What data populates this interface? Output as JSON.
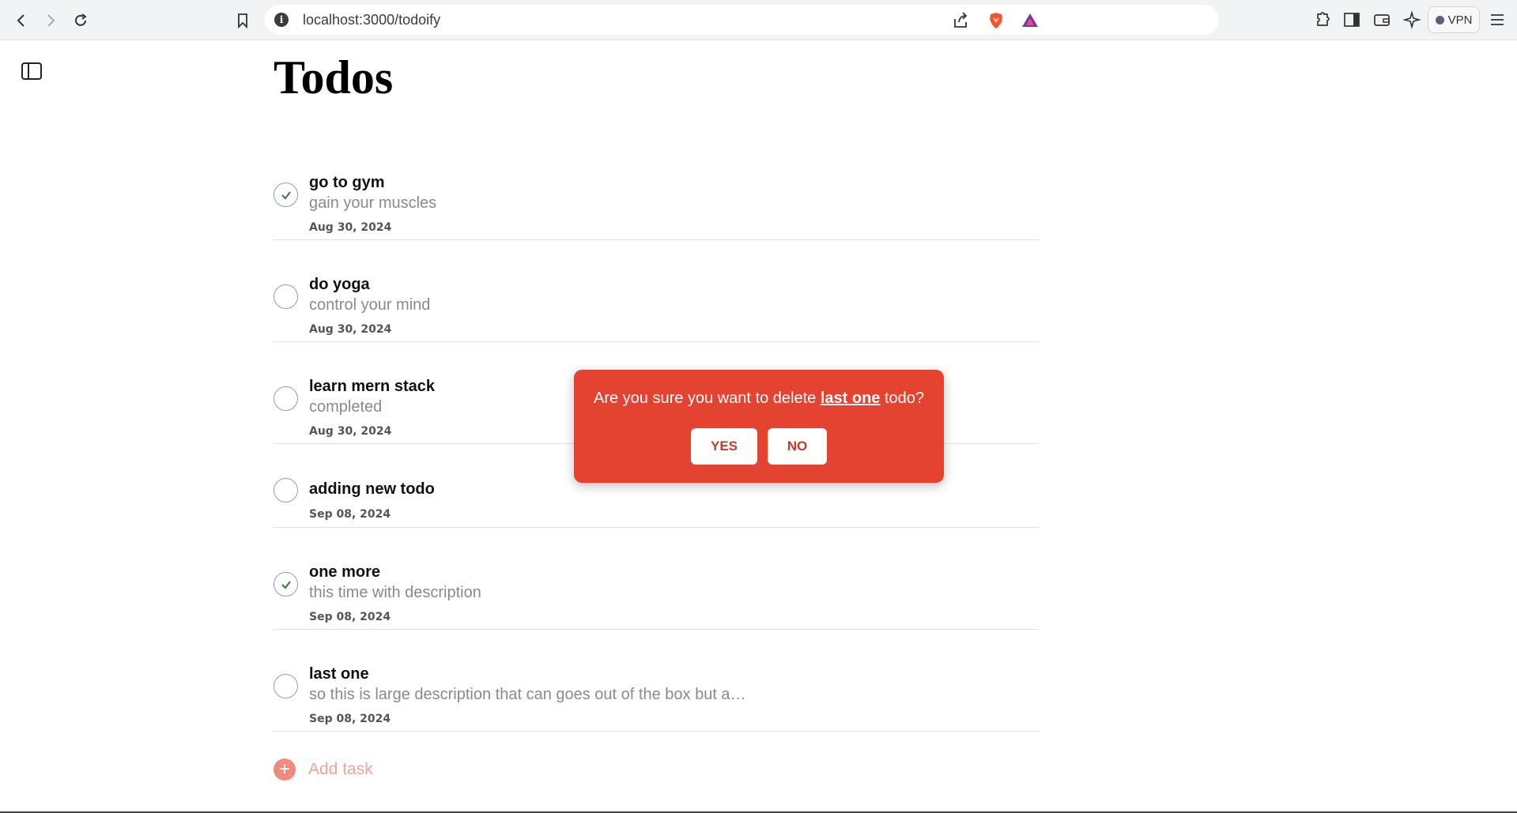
{
  "browser": {
    "url": "localhost:3000/todoify",
    "vpn_label": "VPN"
  },
  "page": {
    "title": "Todos"
  },
  "todos": [
    {
      "title": "go to gym",
      "description": "gain your muscles",
      "date": "Aug 30, 2024",
      "completed": true
    },
    {
      "title": "do yoga",
      "description": "control your mind",
      "date": "Aug 30, 2024",
      "completed": false
    },
    {
      "title": "learn mern stack",
      "description": "completed",
      "date": "Aug 30, 2024",
      "completed": false
    },
    {
      "title": "adding new todo",
      "description": "",
      "date": "Sep 08, 2024",
      "completed": false
    },
    {
      "title": "one more",
      "description": "this time with description",
      "date": "Sep 08, 2024",
      "completed": true
    },
    {
      "title": "last one",
      "description": "so this is large description that can goes out of the box but a…",
      "date": "Sep 08, 2024",
      "completed": false
    }
  ],
  "add_task": {
    "label": "Add task"
  },
  "dialog": {
    "message_prefix": "Are you sure you want to delete ",
    "todo_name": "last one",
    "message_suffix": " todo?",
    "yes_label": "YES",
    "no_label": "NO"
  },
  "colors": {
    "accent": "#e44332",
    "check_green": "#2e7d32"
  }
}
